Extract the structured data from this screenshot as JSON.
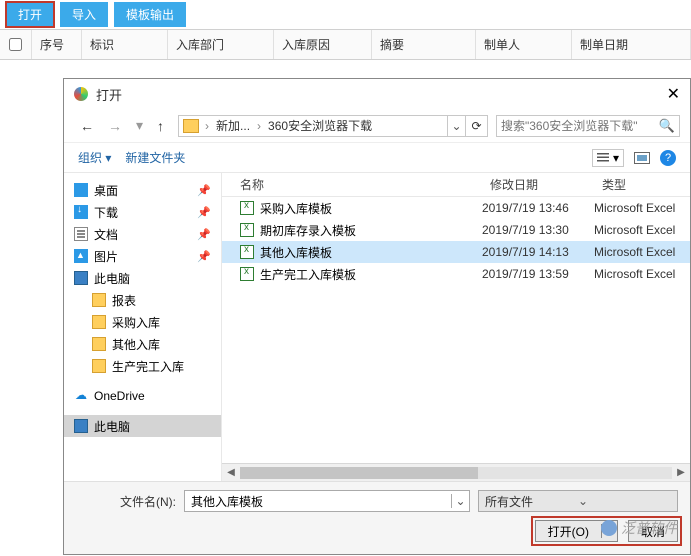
{
  "toolbar": {
    "open": "打开",
    "import": "导入",
    "template_export": "模板输出"
  },
  "columns": {
    "seq": "序号",
    "flag": "标识",
    "dept": "入库部门",
    "reason": "入库原因",
    "summary": "摘要",
    "maker": "制单人",
    "date": "制单日期"
  },
  "dialog": {
    "title": "打开",
    "breadcrumb": {
      "part1": "新加...",
      "part2": "360安全浏览器下载"
    },
    "search_placeholder": "搜索\"360安全浏览器下载\"",
    "organize": "组织",
    "new_folder": "新建文件夹",
    "list_head": {
      "name": "名称",
      "date": "修改日期",
      "type": "类型"
    },
    "tree": {
      "desktop": "桌面",
      "download": "下载",
      "docs": "文档",
      "pics": "图片",
      "thispc": "此电脑",
      "reports": "报表",
      "cgrk": "采购入库",
      "qtrk": "其他入库",
      "scwgrk": "生产完工入库",
      "onedrive": "OneDrive",
      "thispc2": "此电脑"
    },
    "rows": [
      {
        "name": "采购入库模板",
        "date": "2019/7/19 13:46",
        "type": "Microsoft Excel"
      },
      {
        "name": "期初库存录入模板",
        "date": "2019/7/19 13:30",
        "type": "Microsoft Excel"
      },
      {
        "name": "其他入库模板",
        "date": "2019/7/19 14:13",
        "type": "Microsoft Excel",
        "selected": true
      },
      {
        "name": "生产完工入库模板",
        "date": "2019/7/19 13:59",
        "type": "Microsoft Excel"
      }
    ],
    "filename_label": "文件名(N):",
    "filename_value": "其他入库模板",
    "filter_label": "所有文件",
    "btn_open": "打开(O)",
    "btn_cancel": "取消"
  },
  "watermark": "泛普软件"
}
